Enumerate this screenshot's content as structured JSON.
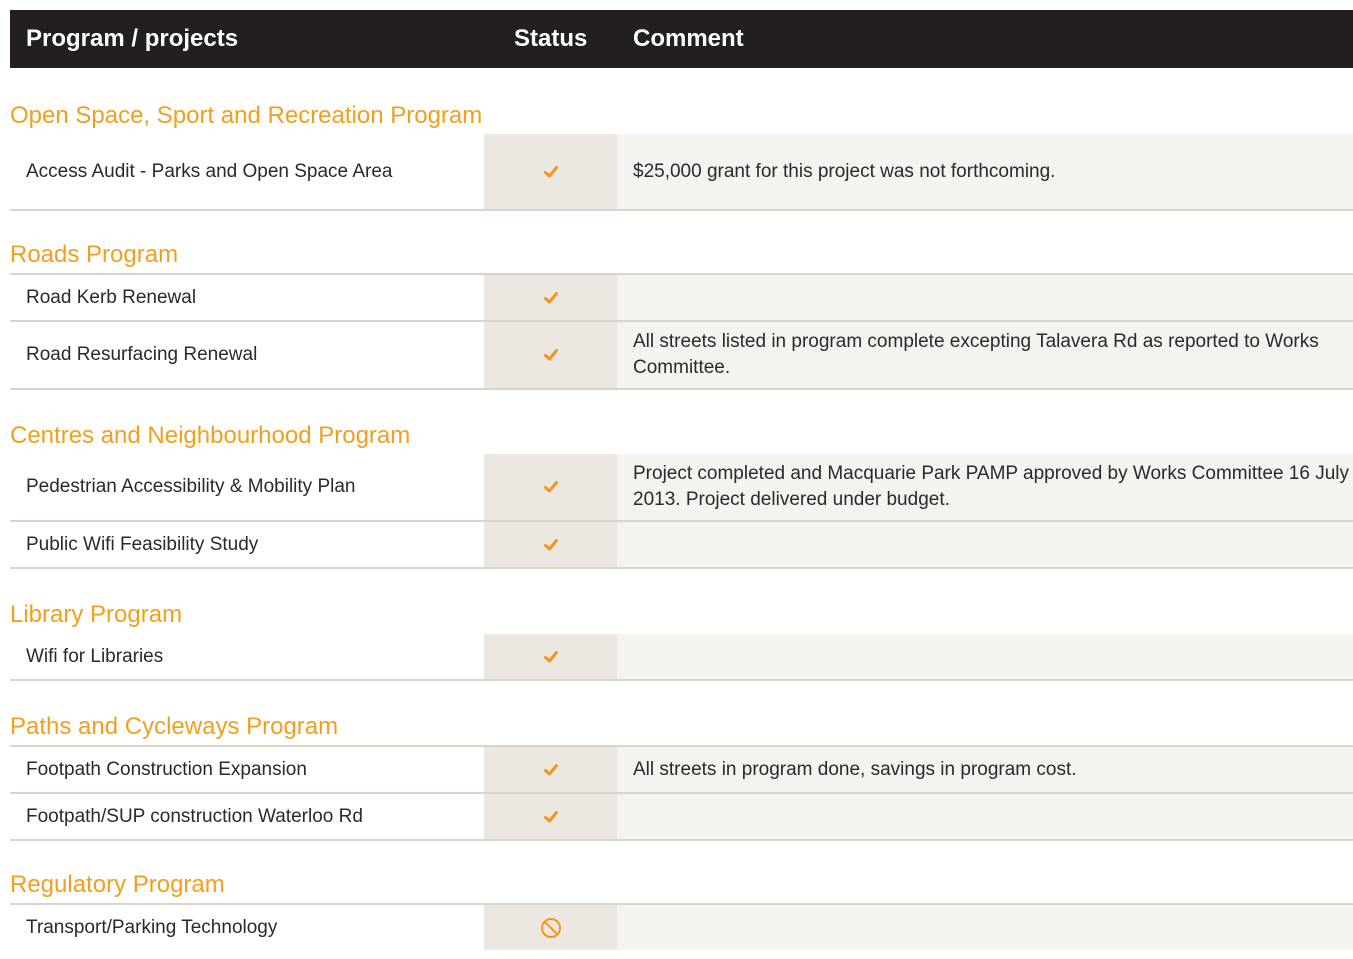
{
  "header": {
    "program_label": "Program / projects",
    "status_label": "Status",
    "comment_label": "Comment"
  },
  "colors": {
    "header_bg": "#231f20",
    "program_title": "#f0a01e",
    "check": "#f0961e",
    "status_cell": "#ece8e1",
    "comment_cell": "#f5f3ef"
  },
  "programs": [
    {
      "title": "Open Space, Sport and Recreation Program",
      "projects": [
        {
          "name": "Access Audit - Parks and Open Space Area",
          "status": "check-icon",
          "comment": "$25,000 grant for this project was not forthcoming."
        }
      ]
    },
    {
      "title": "Roads Program",
      "projects": [
        {
          "name": "Road Kerb Renewal",
          "status": "check-icon",
          "comment": ""
        },
        {
          "name": "Road Resurfacing Renewal",
          "status": "check-icon",
          "comment": "All streets listed in program complete excepting Talavera Rd as reported to Works Committee."
        }
      ]
    },
    {
      "title": "Centres and Neighbourhood Program",
      "projects": [
        {
          "name": "Pedestrian Accessibility & Mobility Plan",
          "status": "check-icon",
          "comment": "Project completed and Macquarie Park PAMP approved by Works Committee 16 July 2013. Project delivered under budget."
        },
        {
          "name": "Public Wifi Feasibility Study",
          "status": "check-icon",
          "comment": ""
        }
      ]
    },
    {
      "title": "Library Program",
      "projects": [
        {
          "name": "Wifi for Libraries",
          "status": "check-icon",
          "comment": ""
        }
      ]
    },
    {
      "title": "Paths and Cycleways Program",
      "projects": [
        {
          "name": "Footpath Construction Expansion",
          "status": "check-icon",
          "comment": "All streets in program done, savings in program cost."
        },
        {
          "name": "Footpath/SUP construction Waterloo Rd",
          "status": "check-icon",
          "comment": ""
        }
      ]
    },
    {
      "title": "Regulatory Program",
      "projects": [
        {
          "name": "Transport/Parking Technology",
          "status": "prohibited-icon",
          "comment": ""
        }
      ]
    }
  ]
}
